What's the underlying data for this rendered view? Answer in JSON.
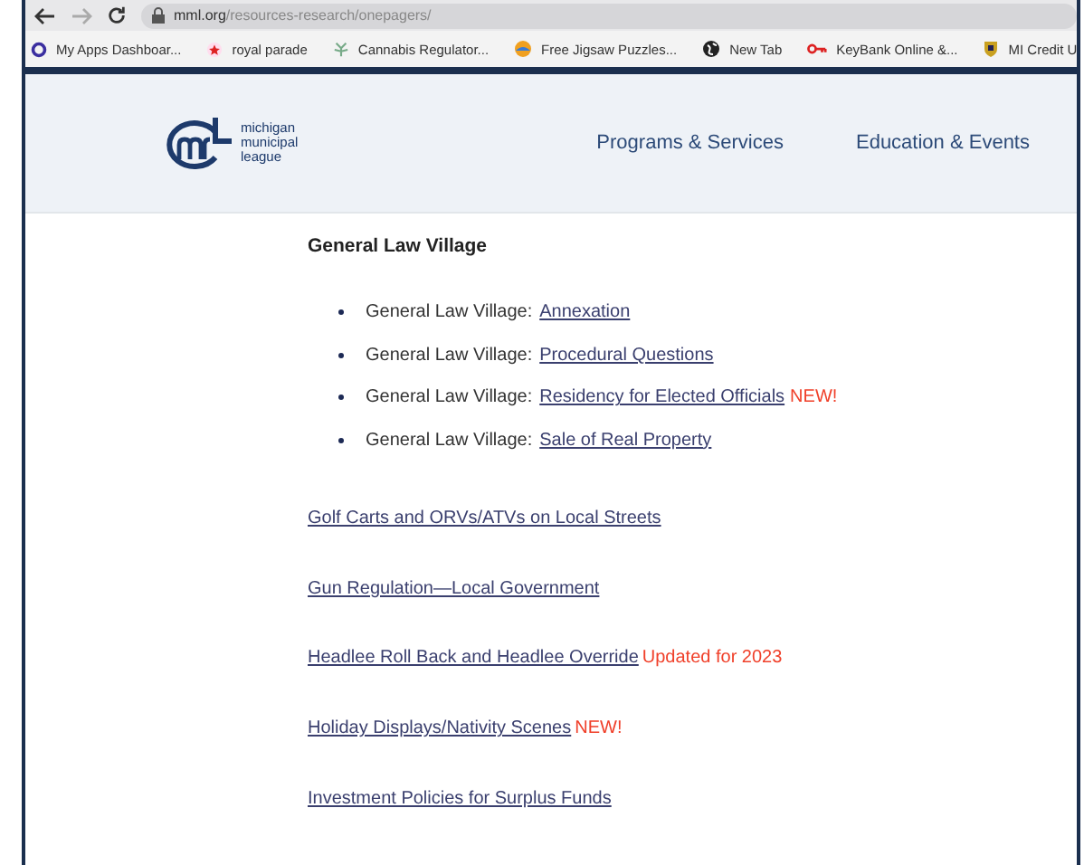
{
  "browser": {
    "url_domain": "mml.org",
    "url_path": "/resources-research/onepagers/",
    "bookmarks": [
      {
        "label": "My Apps Dashboar..."
      },
      {
        "label": "royal parade"
      },
      {
        "label": "Cannabis Regulator..."
      },
      {
        "label": "Free Jigsaw Puzzles..."
      },
      {
        "label": "New Tab"
      },
      {
        "label": "KeyBank Online &..."
      },
      {
        "label": "MI Credit U"
      }
    ]
  },
  "header": {
    "logo_lines": [
      "michigan",
      "municipal",
      "league"
    ],
    "nav": [
      {
        "label": "Programs & Services"
      },
      {
        "label": "Education & Events"
      }
    ]
  },
  "section": {
    "heading": "General Law Village",
    "items": [
      {
        "prefix": "General Law Village:",
        "link": "Annexation"
      },
      {
        "prefix": "General Law Village:",
        "link": "Procedural Questions"
      },
      {
        "prefix": "General Law Village:",
        "link": "Residency for Elected Officials",
        "badge": "NEW!"
      },
      {
        "prefix": "General Law Village:",
        "link": "Sale of Real Property"
      }
    ]
  },
  "links": [
    {
      "text": "Golf Carts and ORVs/ATVs on Local Streets"
    },
    {
      "text": "Gun Regulation—Local Government"
    },
    {
      "text": "Headlee Roll Back and Headlee Override",
      "badge": "Updated for 2023"
    },
    {
      "text": "Holiday Displays/Nativity Scenes",
      "badge": "NEW!"
    },
    {
      "text": "Investment Policies for Surplus Funds"
    }
  ]
}
